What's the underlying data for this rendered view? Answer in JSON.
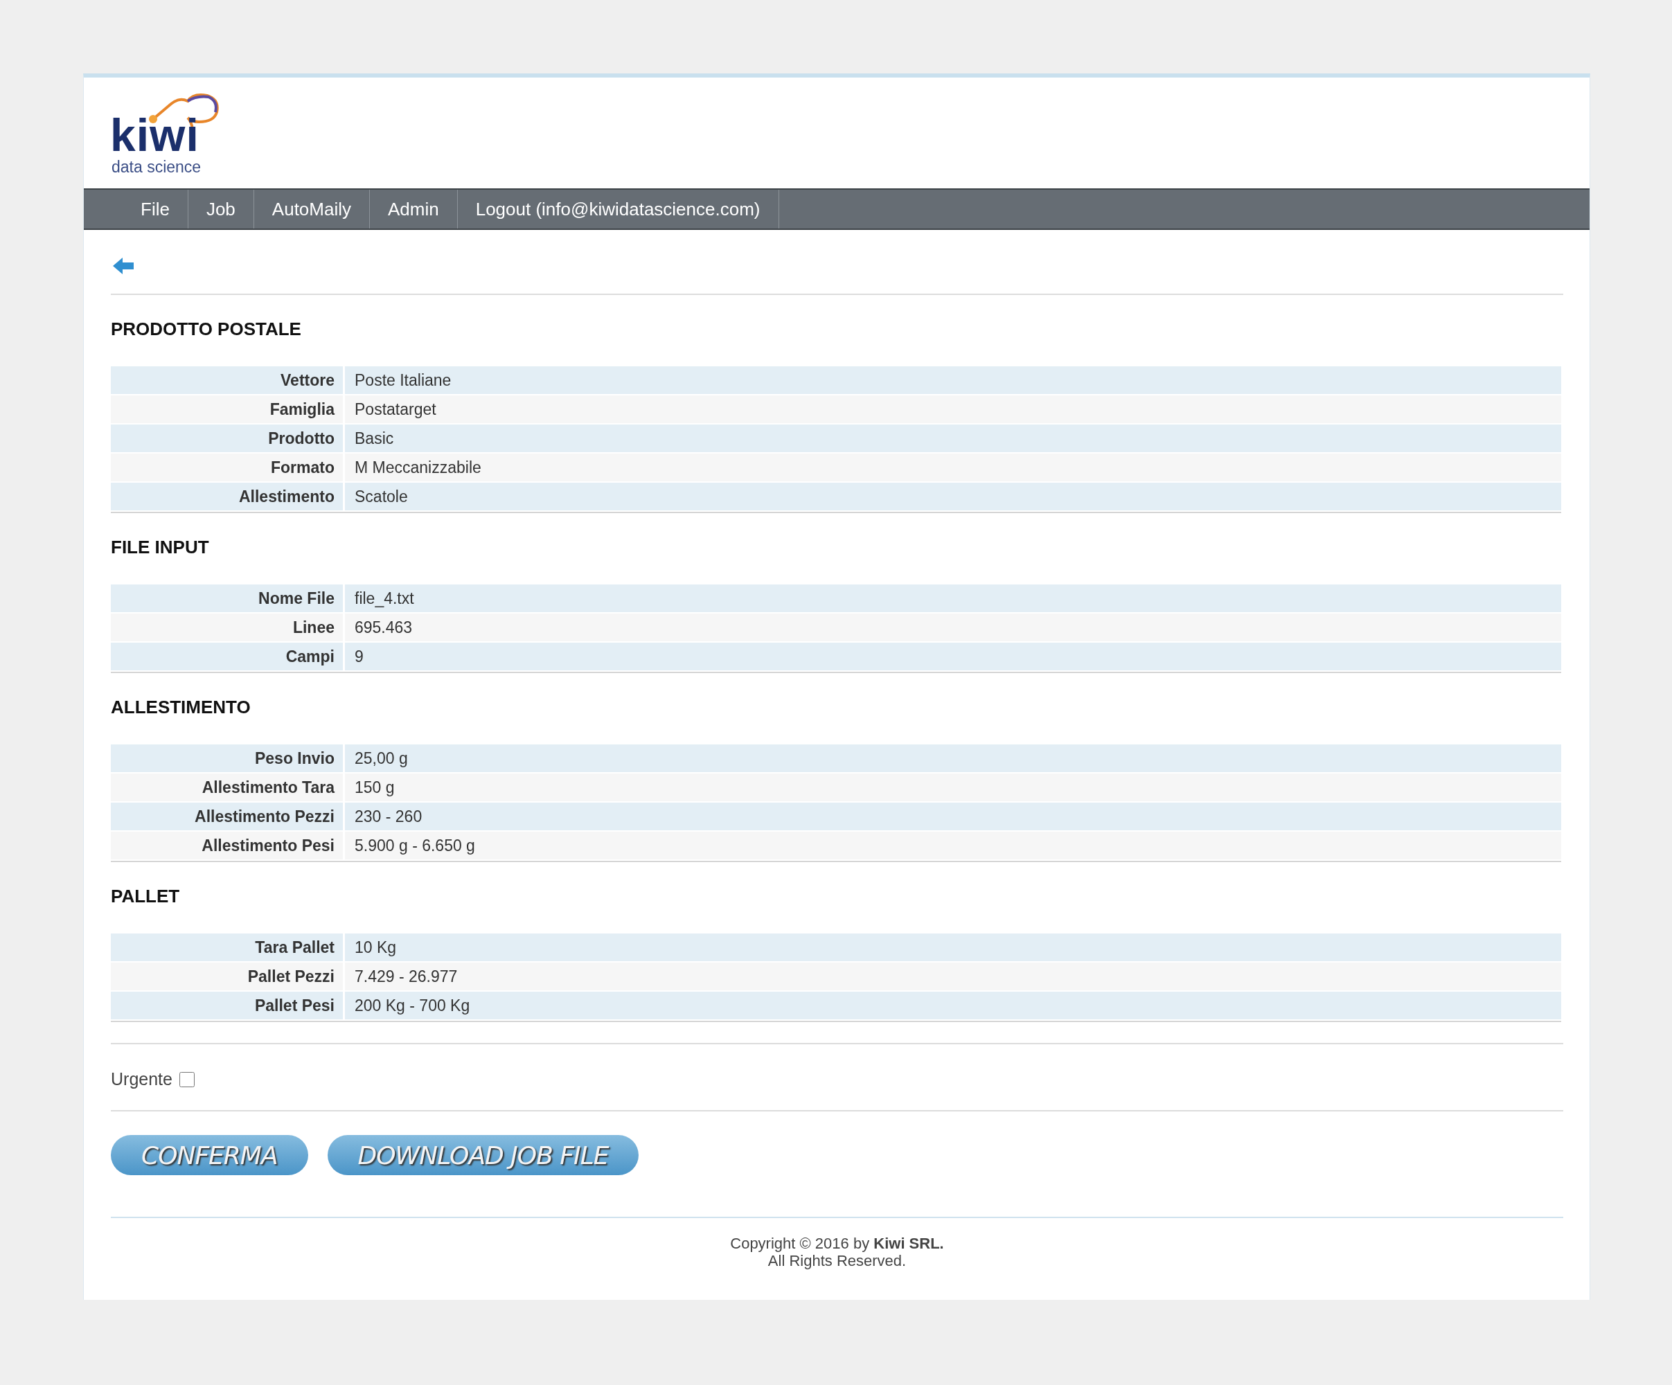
{
  "logo": {
    "name": "kiwi",
    "tagline": "data science"
  },
  "nav": [
    {
      "label": "File"
    },
    {
      "label": "Job"
    },
    {
      "label": "AutoMaily"
    },
    {
      "label": "Admin"
    },
    {
      "label": "Logout (info@kiwidatascience.com)"
    }
  ],
  "sections": [
    {
      "title": "PRODOTTO POSTALE",
      "rows": [
        {
          "label": "Vettore",
          "value": "Poste Italiane"
        },
        {
          "label": "Famiglia",
          "value": "Postatarget"
        },
        {
          "label": "Prodotto",
          "value": "Basic"
        },
        {
          "label": "Formato",
          "value": "M Meccanizzabile"
        },
        {
          "label": "Allestimento",
          "value": "Scatole"
        }
      ]
    },
    {
      "title": "FILE INPUT",
      "rows": [
        {
          "label": "Nome File",
          "value": "file_4.txt"
        },
        {
          "label": "Linee",
          "value": "695.463"
        },
        {
          "label": "Campi",
          "value": "9"
        }
      ]
    },
    {
      "title": "ALLESTIMENTO",
      "rows": [
        {
          "label": "Peso Invio",
          "value": "25,00 g"
        },
        {
          "label": "Allestimento Tara",
          "value": "150 g"
        },
        {
          "label": "Allestimento Pezzi",
          "value": "230 - 260"
        },
        {
          "label": "Allestimento Pesi",
          "value": "5.900 g - 6.650 g"
        }
      ]
    },
    {
      "title": "PALLET",
      "rows": [
        {
          "label": "Tara Pallet",
          "value": "10 Kg"
        },
        {
          "label": "Pallet Pezzi",
          "value": "7.429 - 26.977"
        },
        {
          "label": "Pallet Pesi",
          "value": "200 Kg - 700 Kg"
        }
      ]
    }
  ],
  "urgente": {
    "label": "Urgente",
    "checked": false
  },
  "buttons": [
    {
      "label": "CONFERMA"
    },
    {
      "label": "DOWNLOAD JOB FILE"
    }
  ],
  "footer": {
    "line1": "Copyright © 2016 by **Kiwi SRL.**",
    "line2": "All Rights Reserved."
  }
}
